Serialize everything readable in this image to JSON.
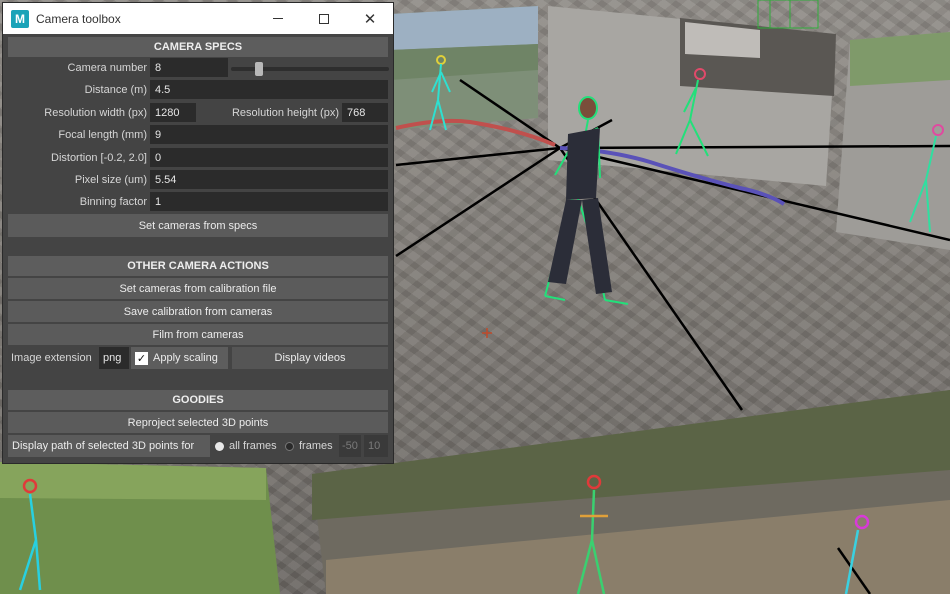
{
  "window": {
    "icon_letter": "M",
    "title": "Camera toolbox",
    "minimize": "minimize",
    "maximize": "maximize",
    "close": "close"
  },
  "camera_specs": {
    "header": "CAMERA SPECS",
    "camera_number_label": "Camera number",
    "camera_number": "8",
    "camera_number_slider": 0.16,
    "distance_label": "Distance (m)",
    "distance": "4.5",
    "res_width_label": "Resolution width (px)",
    "res_width": "1280",
    "res_height_label": "Resolution height (px)",
    "res_height": "768",
    "focal_label": "Focal length (mm)",
    "focal": "9",
    "distortion_label": "Distortion [-0.2, 2.0]",
    "distortion": "0",
    "pixel_size_label": "Pixel size (um)",
    "pixel_size": "5.54",
    "binning_label": "Binning factor",
    "binning": "1",
    "set_from_specs": "Set cameras from specs"
  },
  "other_actions": {
    "header": "OTHER CAMERA ACTIONS",
    "set_from_calibration": "Set cameras from calibration file",
    "save_calibration": "Save calibration from cameras",
    "film": "Film from cameras",
    "image_extension_label": "Image extension",
    "image_extension": "png",
    "apply_scaling": "Apply scaling",
    "apply_scaling_checked": true,
    "display_videos": "Display videos"
  },
  "goodies": {
    "header": "GOODIES",
    "reproject": "Reproject selected 3D points",
    "display_path_label": "Display path of selected 3D points for",
    "all_frames": "all frames",
    "frames": "frames",
    "frame_start": "-50",
    "frame_end": "10"
  },
  "colors": {
    "panel": "#444444",
    "section_header": "#5d5d5d",
    "field": "#2b2b2b",
    "skeleton_green": "#22e07a",
    "path_red": "#c0504d",
    "path_blue": "#5a52b8"
  }
}
